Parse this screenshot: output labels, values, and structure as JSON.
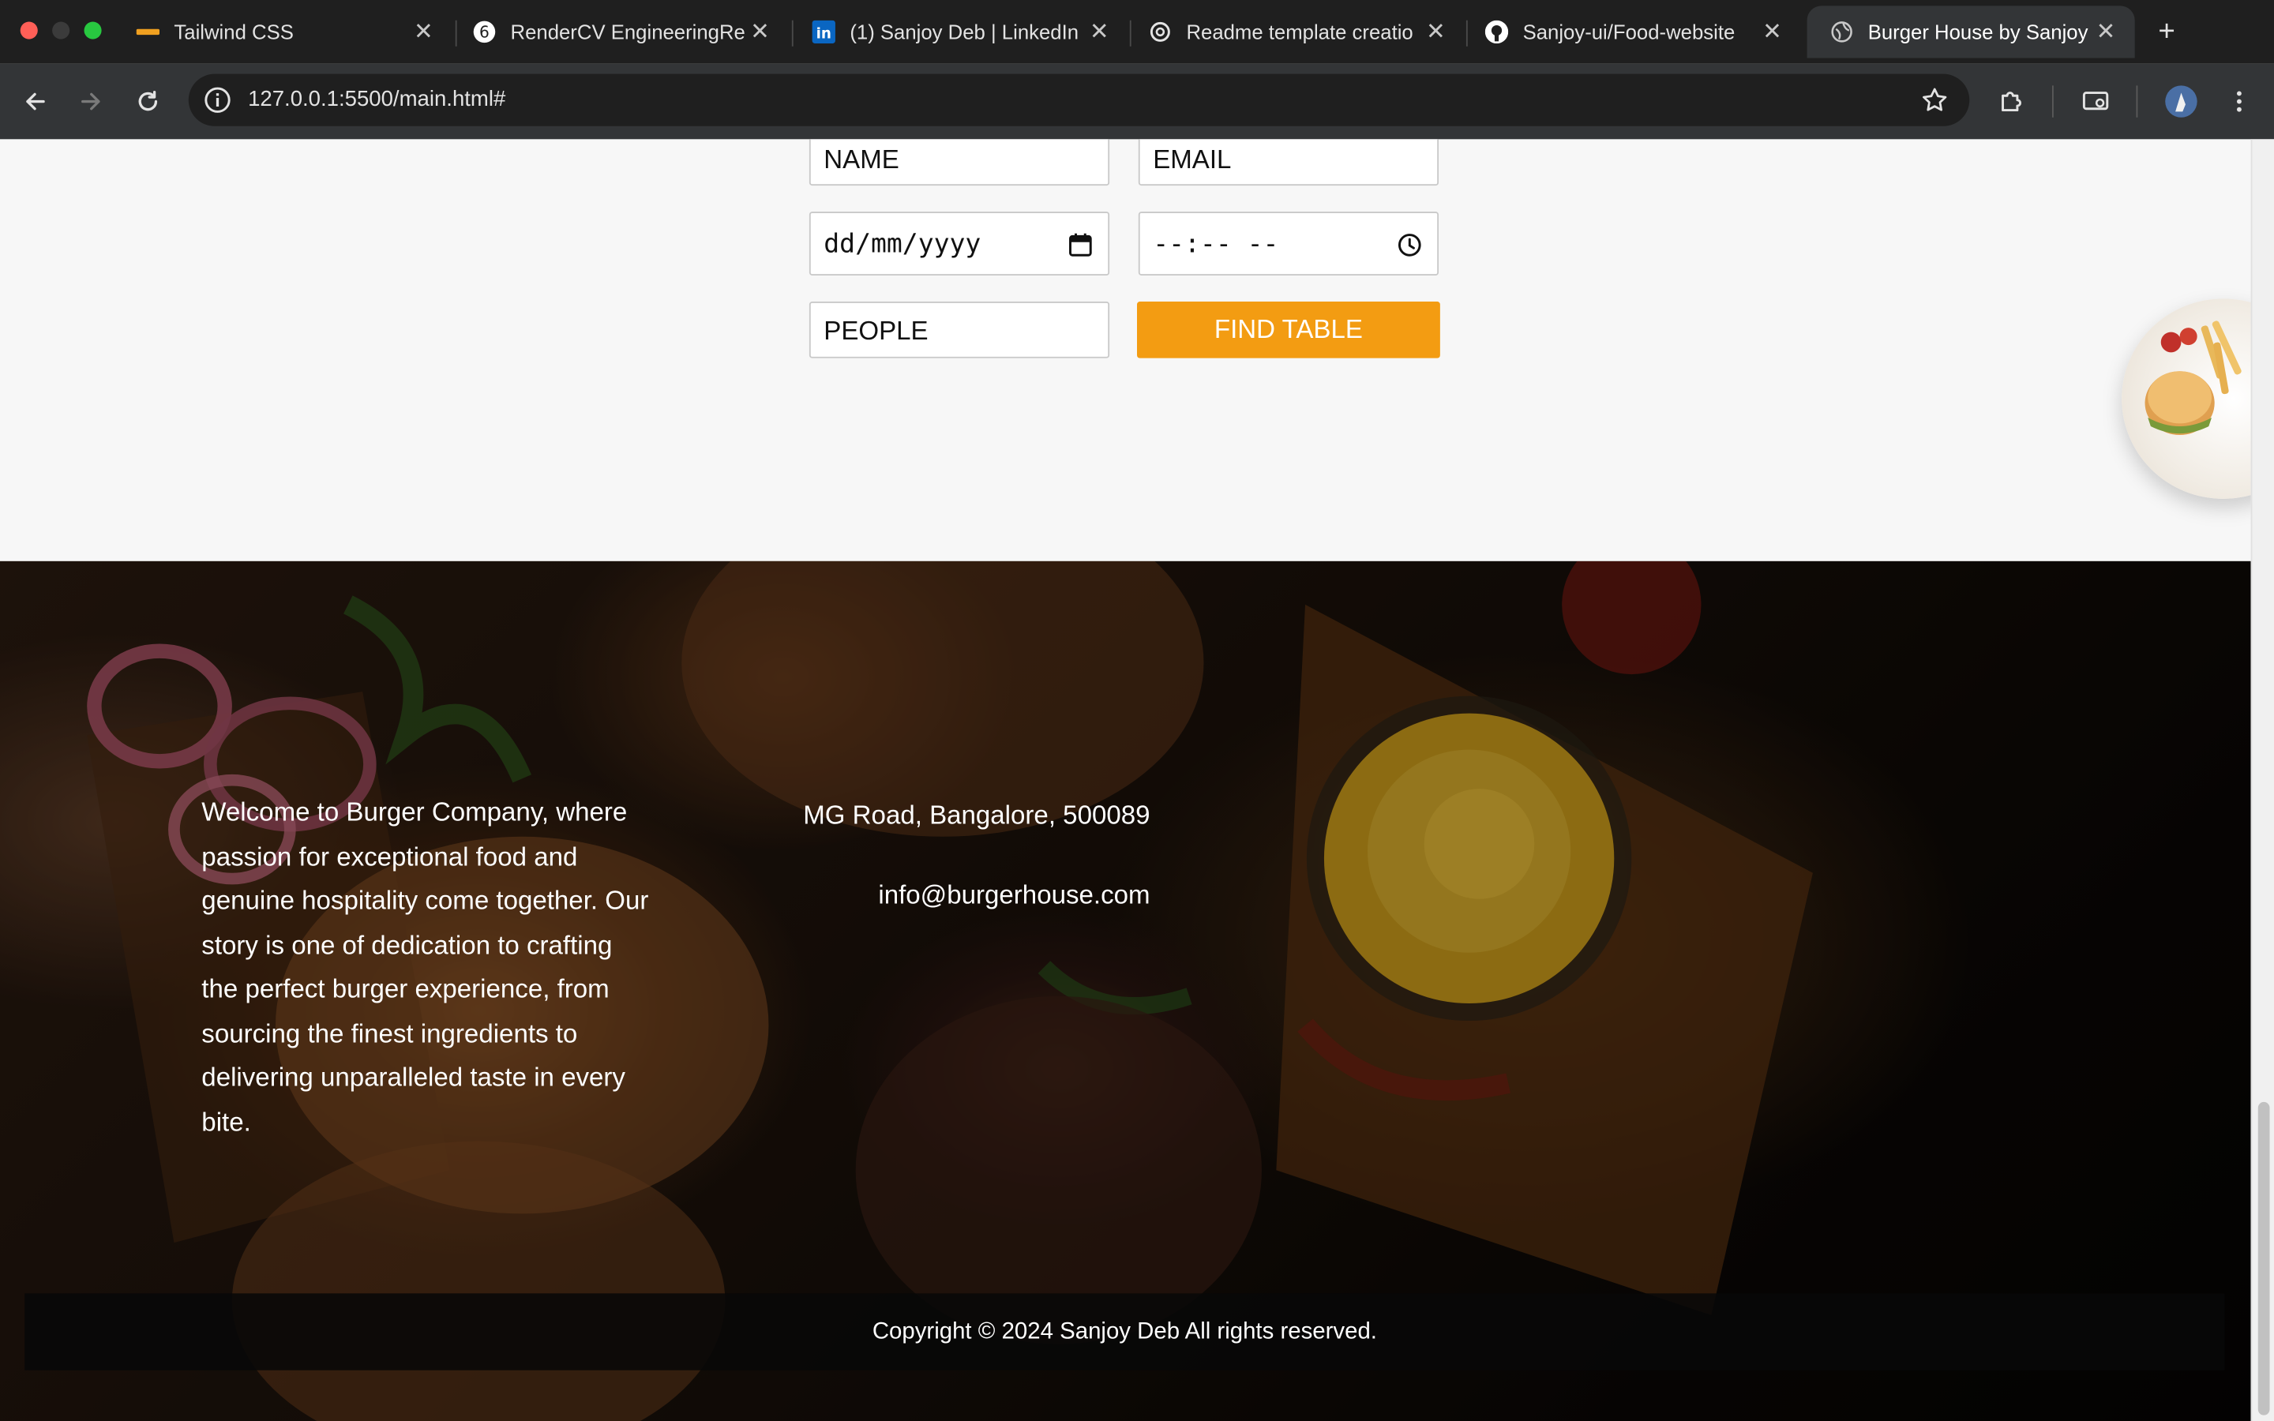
{
  "browser": {
    "tabs": [
      {
        "title": "Tailwind CSS",
        "active": false
      },
      {
        "title": "RenderCV EngineeringRe",
        "active": false
      },
      {
        "title": "(1) Sanjoy Deb | LinkedIn",
        "active": false
      },
      {
        "title": "Readme template creatio",
        "active": false
      },
      {
        "title": "Sanjoy-ui/Food-website",
        "active": false
      },
      {
        "title": "Burger House by Sanjoy",
        "active": true
      }
    ],
    "url": "127.0.0.1:5500/main.html#",
    "colors": {
      "tab_strip": "#1f1f1f",
      "toolbar": "#333537",
      "linkedin": "#0a66c2"
    }
  },
  "reservation": {
    "name_placeholder": "NAME",
    "email_placeholder": "EMAIL",
    "date_placeholder": "dd/mm/yyyy",
    "time_placeholder": "--:-- --",
    "people_placeholder": "PEOPLE",
    "find_table_label": "FIND TABLE",
    "accent": "#f39c12"
  },
  "footer": {
    "about": "Welcome to Burger Company, where passion for exceptional food and genuine hospitality come together. Our story is one of dedication to crafting the perfect burger experience, from sourcing the finest ingredients to delivering unparalleled taste in every bite.",
    "address": "MG Road, Bangalore, 500089",
    "email": "info@burgerhouse.com",
    "copyright": "Copyright © 2024 Sanjoy Deb All rights reserved."
  }
}
